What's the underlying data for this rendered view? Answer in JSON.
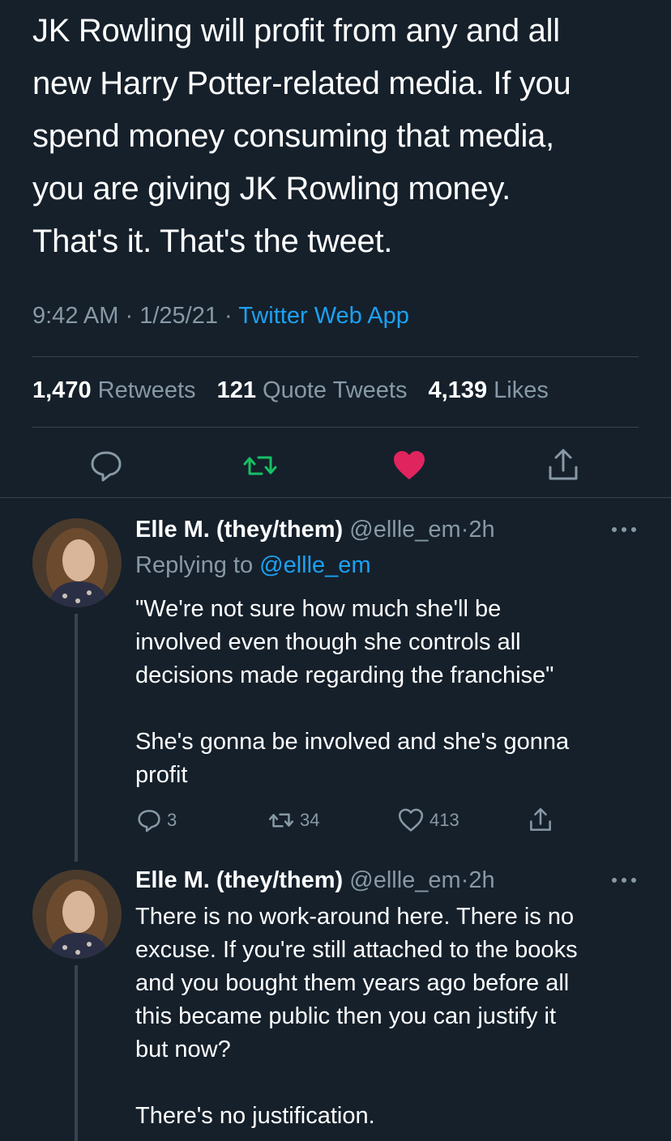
{
  "tweet": {
    "text": "JK Rowling will profit from any and all\nnew Harry Potter-related media. If you\nspend money consuming that media,\nyou are giving JK Rowling money.\nThat's it. That's the tweet.",
    "time": "9:42 AM",
    "date": "1/25/21",
    "separator": "·",
    "source": "Twitter Web App",
    "stats": {
      "retweets_count": "1,470",
      "retweets_label": "Retweets",
      "quotes_count": "121",
      "quotes_label": "Quote Tweets",
      "likes_count": "4,139",
      "likes_label": "Likes"
    },
    "actions": [
      {
        "icon": "reply-icon"
      },
      {
        "icon": "retweet-icon",
        "color": "#17bf63"
      },
      {
        "icon": "heart-filled-icon",
        "color": "#e0245e"
      },
      {
        "icon": "share-icon"
      }
    ]
  },
  "replies": [
    {
      "name": "Elle M. (they/them)",
      "handle": "@ellle_em",
      "separator": "·",
      "time": "2h",
      "replying_prefix": "Replying to",
      "replying_handle": "@ellle_em",
      "text": "\"We're not sure how much she'll be\ninvolved even though she controls all\ndecisions made regarding the franchise\"\n\nShe's gonna be involved and she's gonna\nprofit",
      "reply_count": "3",
      "retweet_count": "34",
      "like_count": "413"
    },
    {
      "name": "Elle M. (they/them)",
      "handle": "@ellle_em",
      "separator": "·",
      "time": "2h",
      "text": "There is no work-around here. There is no\nexcuse. If you're still attached to the books\nand you bought them years ago before all\nthis became public then you can justify it\nbut now?\n\nThere's no justification."
    }
  ],
  "colors": {
    "background": "#15202b",
    "text": "#ffffff",
    "secondary": "#8899a6",
    "accent": "#1da1f2",
    "divider": "#38444d"
  }
}
